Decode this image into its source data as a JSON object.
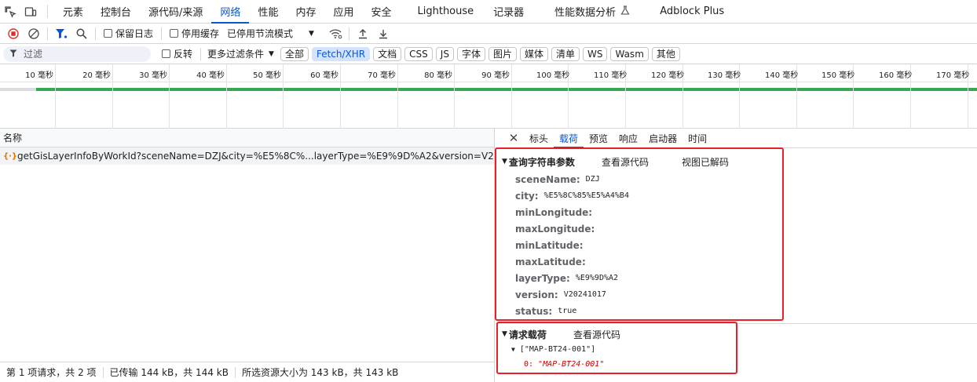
{
  "main_tabs": [
    "元素",
    "控制台",
    "源代码/来源",
    "网络",
    "性能",
    "内存",
    "应用",
    "安全",
    "Lighthouse",
    "记录器",
    "性能数据分析",
    "Adblock Plus"
  ],
  "toolbar": {
    "preserve_log": "保留日志",
    "disable_cache": "停用缓存",
    "throttle": "已停用节流模式"
  },
  "filter": {
    "placeholder": "过滤",
    "invert": "反转",
    "more_filters": "更多过滤条件",
    "chips": [
      "全部",
      "Fetch/XHR",
      "文档",
      "CSS",
      "JS",
      "字体",
      "图片",
      "媒体",
      "清单",
      "WS",
      "Wasm",
      "其他"
    ]
  },
  "timeline": {
    "ticks": [
      "10 毫秒",
      "20 毫秒",
      "30 毫秒",
      "40 毫秒",
      "50 毫秒",
      "60 毫秒",
      "70 毫秒",
      "80 毫秒",
      "90 毫秒",
      "100 毫秒",
      "110 毫秒",
      "120 毫秒",
      "130 毫秒",
      "140 毫秒",
      "150 毫秒",
      "160 毫秒",
      "170 毫秒"
    ]
  },
  "list": {
    "header": "名称",
    "request": "getGisLayerInfoByWorkId?sceneName=DZJ&city=%E5%8C%...layerType=%E9%9D%A2&version=V202..."
  },
  "status": {
    "requests": "第 1 项请求，共 2 项",
    "transferred": "已传输 144 kB，共 144 kB",
    "resources": "所选资源大小为 143 kB，共 143 kB"
  },
  "details": {
    "tabs": [
      "标头",
      "载荷",
      "预览",
      "响应",
      "启动器",
      "时间"
    ],
    "query": {
      "title": "查询字符串参数",
      "view_source": "查看源代码",
      "view_decoded": "视图已解码",
      "params": [
        {
          "key": "sceneName:",
          "value": "DZJ"
        },
        {
          "key": "city:",
          "value": "%E5%8C%85%E5%A4%B4"
        },
        {
          "key": "minLongitude:",
          "value": ""
        },
        {
          "key": "maxLongitude:",
          "value": ""
        },
        {
          "key": "minLatitude:",
          "value": ""
        },
        {
          "key": "maxLatitude:",
          "value": ""
        },
        {
          "key": "layerType:",
          "value": "%E9%9D%A2"
        },
        {
          "key": "version:",
          "value": "V20241017"
        },
        {
          "key": "status:",
          "value": "true"
        }
      ]
    },
    "payload": {
      "title": "请求载荷",
      "view_source": "查看源代码",
      "array_line": "[\"MAP-BT24-001\"]",
      "item_index": "0:",
      "item_value": "\"MAP-BT24-001\""
    }
  },
  "colors": {
    "accent": "#0b57d0",
    "annotation_red": "#e5222b",
    "timeline_green": "#34a853"
  }
}
